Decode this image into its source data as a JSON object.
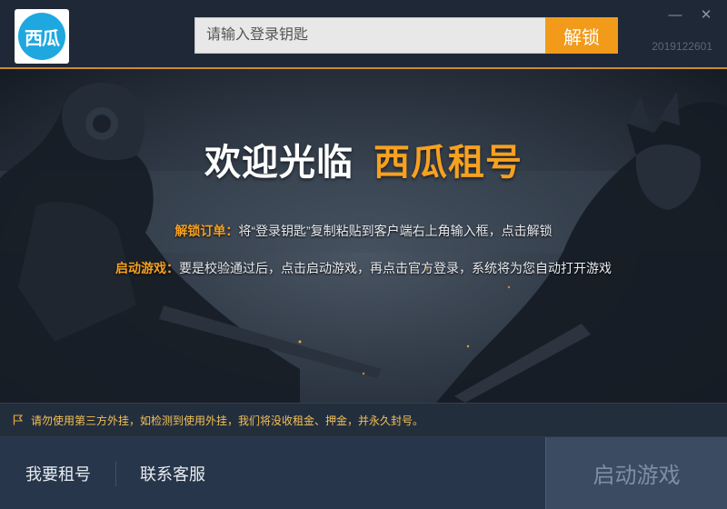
{
  "app": {
    "logo_text": "西瓜",
    "version": "2019122601"
  },
  "header": {
    "key_placeholder": "请输入登录钥匙",
    "unlock_label": "解锁",
    "minimize_glyph": "—",
    "close_glyph": "✕"
  },
  "banner": {
    "welcome": "欢迎光临",
    "brand": "西瓜租号",
    "unlock_label": "解锁订单：",
    "unlock_text": "将“登录钥匙”复制粘贴到客户端右上角输入框，点击解锁",
    "launch_label": "启动游戏：",
    "launch_text": "要是校验通过后，点击启动游戏，再点击官方登录，系统将为您自动打开游戏"
  },
  "notice": {
    "icon": "flag-icon",
    "text": "请勿使用第三方外挂，如检测到使用外挂，我们将没收租金、押金，并永久封号。"
  },
  "footer": {
    "rent_label": "我要租号",
    "contact_label": "联系客服",
    "launch_label": "启动游戏"
  },
  "colors": {
    "accent": "#f29b1a",
    "title_bg": "#1e2836",
    "footer_bg": "#27364a"
  }
}
